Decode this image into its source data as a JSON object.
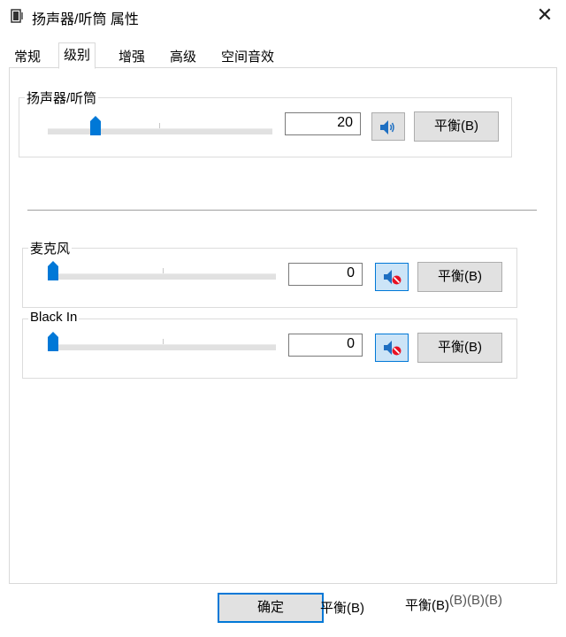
{
  "window": {
    "title": "扬声器/听筒 属性",
    "close_glyph": "✕"
  },
  "tabs": [
    {
      "label": "常规",
      "active": false
    },
    {
      "label": "级别",
      "active": true
    },
    {
      "label": "增强",
      "active": false
    },
    {
      "label": "高级",
      "active": false
    },
    {
      "label": "空间音效",
      "active": false
    }
  ],
  "levels": {
    "speaker": {
      "label": "扬声器/听筒",
      "value": "20",
      "level_percent": 20,
      "muted": false,
      "mute_icon": "speaker-icon",
      "balance_label": "平衡(B)"
    },
    "microphone": {
      "label": "麦克风",
      "value": "0",
      "level_percent": 0,
      "muted": true,
      "mute_icon": "speaker-muted-icon",
      "balance_label": "平衡(B)"
    },
    "black_in": {
      "label": "Black In",
      "value": "0",
      "level_percent": 0,
      "muted": true,
      "mute_icon": "speaker-muted-icon",
      "balance_label": "平衡(B)"
    }
  },
  "footer": {
    "ok_label": "确定",
    "ghost_1": "平衡(B)",
    "ghost_2": "平衡(B)",
    "ghost_3": "(B)(B)(B)"
  },
  "colors": {
    "accent": "#0078d7",
    "button_face": "#e1e1e1",
    "mute_red": "#e81123"
  }
}
